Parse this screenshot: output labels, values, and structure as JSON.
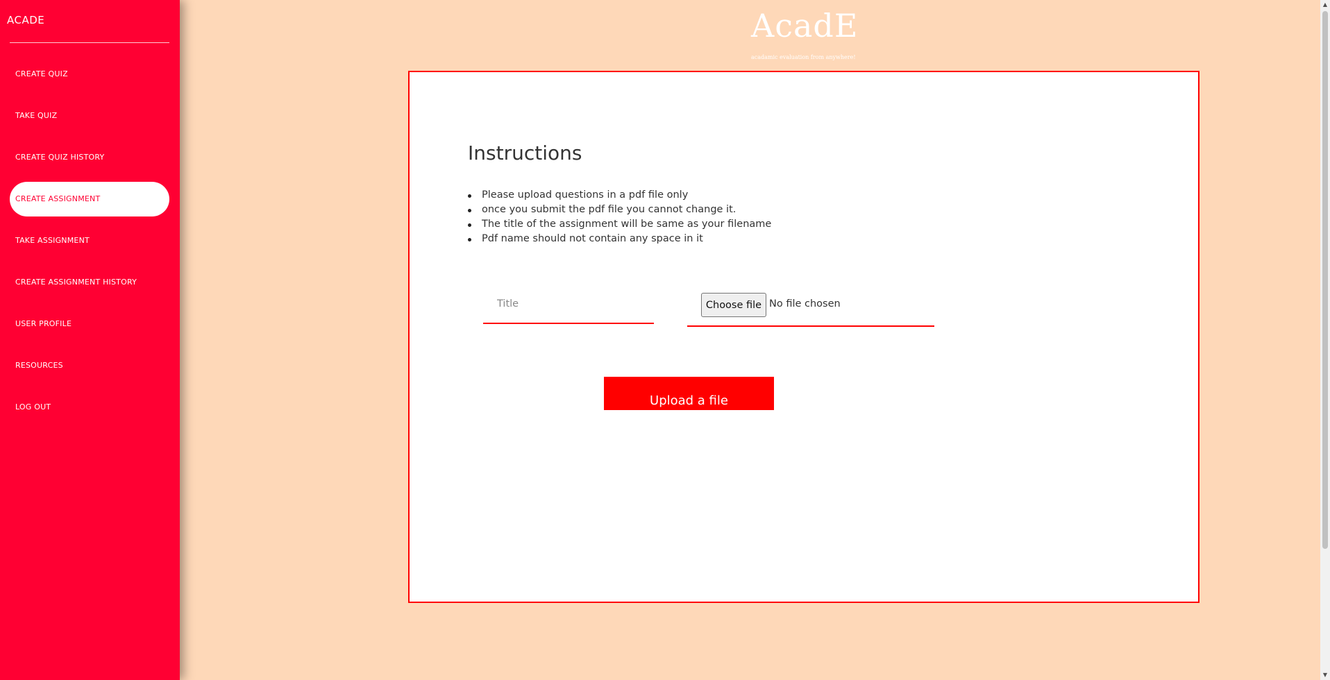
{
  "sidebar": {
    "brand": "ACADE",
    "items": [
      {
        "label": "CREATE QUIZ",
        "active": false
      },
      {
        "label": "TAKE QUIZ",
        "active": false
      },
      {
        "label": "CREATE QUIZ HISTORY",
        "active": false
      },
      {
        "label": "CREATE ASSIGNMENT",
        "active": true
      },
      {
        "label": "TAKE ASSIGNMENT",
        "active": false
      },
      {
        "label": "CREATE ASSIGNMENT HISTORY",
        "active": false
      },
      {
        "label": "USER PROFILE",
        "active": false
      },
      {
        "label": "RESOURCES",
        "active": false
      },
      {
        "label": "LOG OUT",
        "active": false
      }
    ]
  },
  "header": {
    "title": "AcadE",
    "subtitle": "acadamic evaluation from anywhere!"
  },
  "main": {
    "instructions_title": "Instructions",
    "instructions": [
      "Please upload questions in a pdf file only",
      "once you submit the pdf file you cannot change it.",
      "The title of the assignment will be same as your filename",
      "Pdf name should not contain any space in it"
    ],
    "title_input": {
      "placeholder": "Title",
      "value": ""
    },
    "file_input": {
      "button_label": "Choose file",
      "status": "No file chosen"
    },
    "upload_button": "Upload a file"
  },
  "colors": {
    "sidebar": "#ff0033",
    "background": "#fed8b8",
    "accent": "#ff0000",
    "card": "#ffffff"
  }
}
